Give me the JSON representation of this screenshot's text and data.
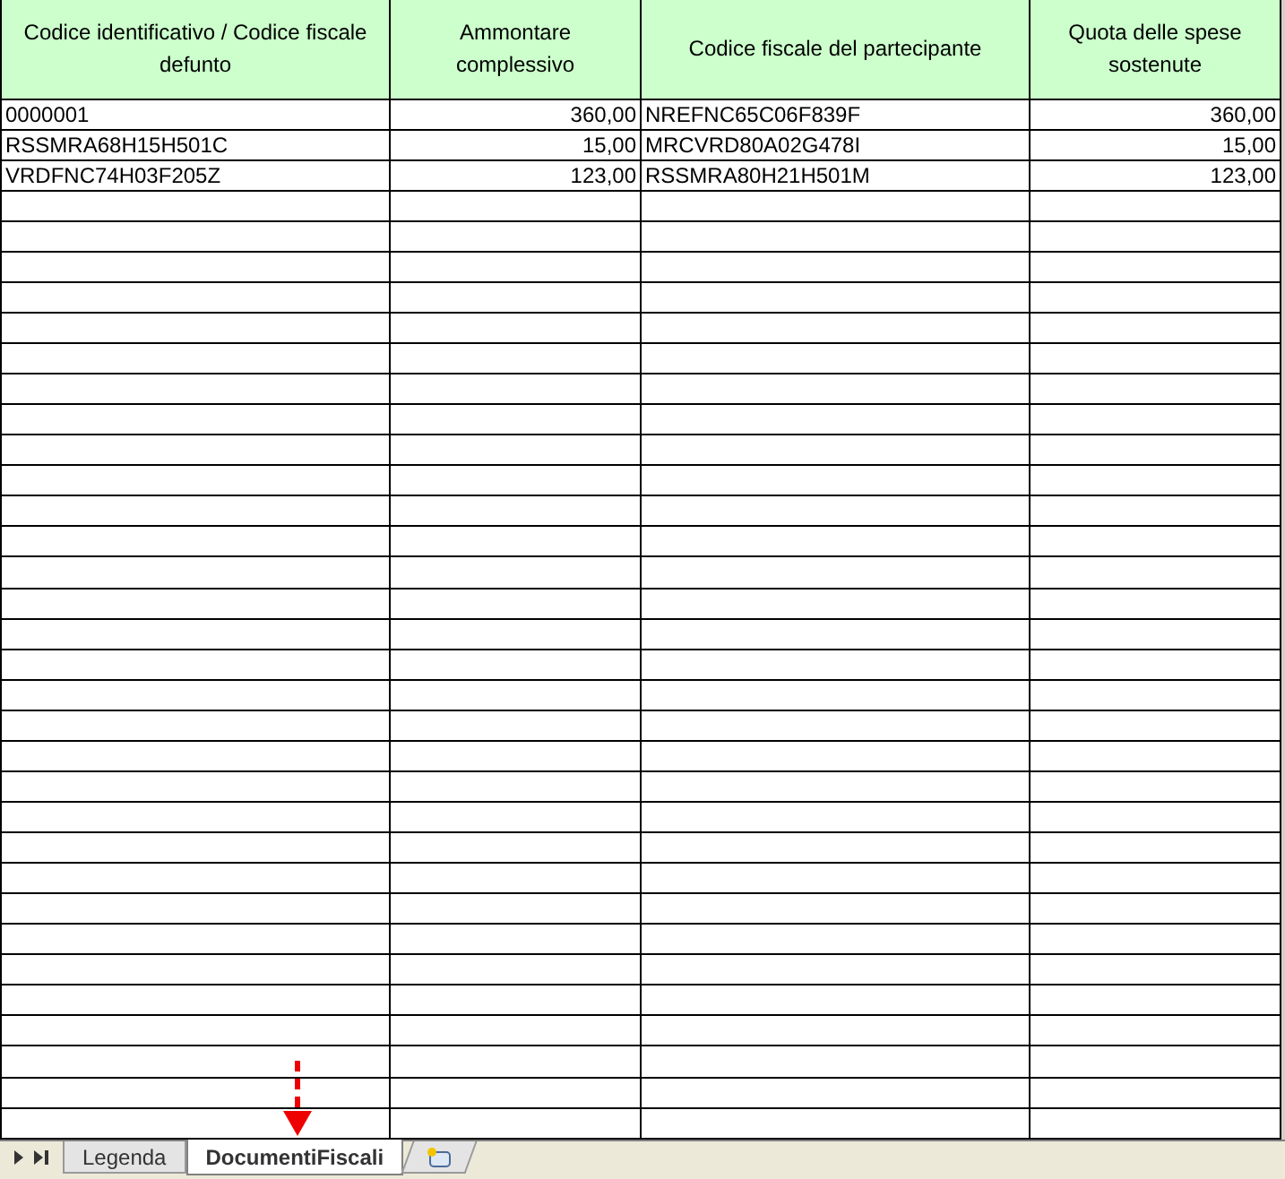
{
  "table": {
    "columns": [
      "Codice identificativo / Codice fiscale defunto",
      "Ammontare complessivo",
      "Codice fiscale del partecipante",
      "Quota delle spese sostenute"
    ],
    "rows": [
      [
        "0000001",
        "360,00",
        "NREFNC65C06F839F",
        "360,00"
      ],
      [
        "RSSMRA68H15H501C",
        "15,00",
        "MRCVRD80A02G478I",
        "15,00"
      ],
      [
        "VRDFNC74H03F205Z",
        "123,00",
        "RSSMRA80H21H501M",
        "123,00"
      ]
    ]
  },
  "sheet_tabs": [
    {
      "label": "Legenda",
      "selected": false
    },
    {
      "label": "DocumentiFiscali",
      "selected": true
    }
  ]
}
